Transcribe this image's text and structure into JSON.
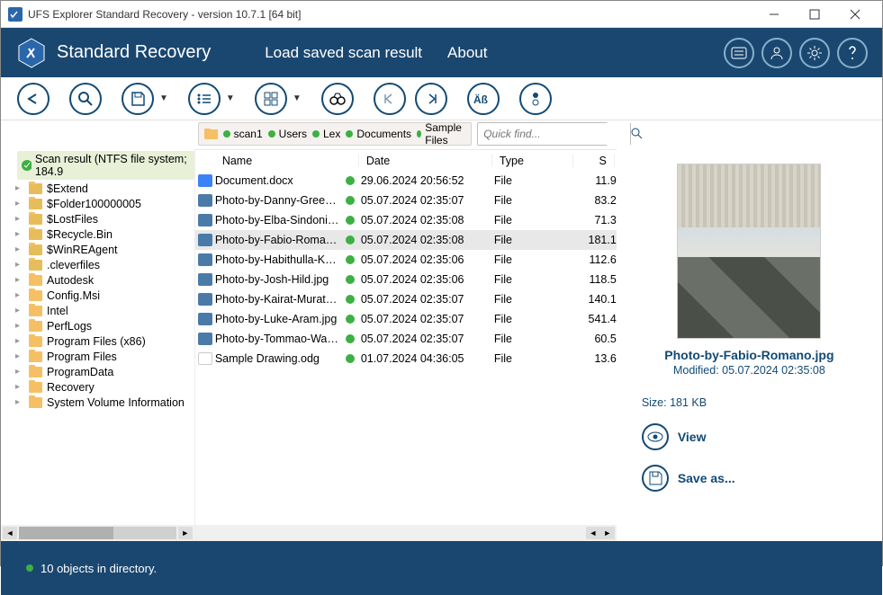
{
  "window": {
    "title": "UFS Explorer Standard Recovery - version 10.7.1 [64 bit]"
  },
  "header": {
    "app_name": "Standard Recovery",
    "menu": {
      "load_scan": "Load saved scan result",
      "about": "About"
    }
  },
  "search": {
    "placeholder": "Quick find..."
  },
  "breadcrumb": {
    "items": [
      {
        "label": "scan1"
      },
      {
        "label": "Users"
      },
      {
        "label": "Lex"
      },
      {
        "label": "Documents"
      },
      {
        "label": "Sample Files"
      }
    ]
  },
  "tree": {
    "root": "Scan result (NTFS file system; 184.9",
    "folders": [
      "$Extend",
      "$Folder100000005",
      "$LostFiles",
      "$Recycle.Bin",
      "$WinREAgent",
      ".cleverfiles",
      "Autodesk",
      "Config.Msi",
      "Intel",
      "PerfLogs",
      "Program Files (x86)",
      "Program Files",
      "ProgramData",
      "Recovery",
      "System Volume Information"
    ]
  },
  "columns": {
    "name": "Name",
    "date": "Date",
    "type": "Type",
    "size": "S"
  },
  "files": [
    {
      "name": "Document.docx",
      "date": "29.06.2024 20:56:52",
      "type": "File",
      "size": "11.9",
      "icon": "doc"
    },
    {
      "name": "Photo-by-Danny-Greenb...",
      "date": "05.07.2024 02:35:07",
      "type": "File",
      "size": "83.2",
      "icon": "img"
    },
    {
      "name": "Photo-by-Elba-Sindoni.jpg",
      "date": "05.07.2024 02:35:08",
      "type": "File",
      "size": "71.3",
      "icon": "img"
    },
    {
      "name": "Photo-by-Fabio-Romano....",
      "date": "05.07.2024 02:35:08",
      "type": "File",
      "size": "181.1",
      "icon": "img",
      "selected": true
    },
    {
      "name": "Photo-by-Habithulla-K.jpg",
      "date": "05.07.2024 02:35:06",
      "type": "File",
      "size": "112.6",
      "icon": "img"
    },
    {
      "name": "Photo-by-Josh-Hild.jpg",
      "date": "05.07.2024 02:35:06",
      "type": "File",
      "size": "118.5",
      "icon": "img"
    },
    {
      "name": "Photo-by-Kairat-Muratali...",
      "date": "05.07.2024 02:35:07",
      "type": "File",
      "size": "140.1",
      "icon": "img"
    },
    {
      "name": "Photo-by-Luke-Aram.jpg",
      "date": "05.07.2024 02:35:07",
      "type": "File",
      "size": "541.4",
      "icon": "img"
    },
    {
      "name": "Photo-by-Tommao-Wang...",
      "date": "05.07.2024 02:35:07",
      "type": "File",
      "size": "60.5",
      "icon": "img"
    },
    {
      "name": "Sample Drawing.odg",
      "date": "01.07.2024 04:36:05",
      "type": "File",
      "size": "13.6",
      "icon": "odg"
    }
  ],
  "preview": {
    "filename": "Photo-by-Fabio-Romano.jpg",
    "modified_label": "Modified: 05.07.2024 02:35:08",
    "size_label": "Size: 181 KB",
    "view": "View",
    "saveas": "Save as..."
  },
  "status": {
    "text": "10 objects in directory."
  }
}
